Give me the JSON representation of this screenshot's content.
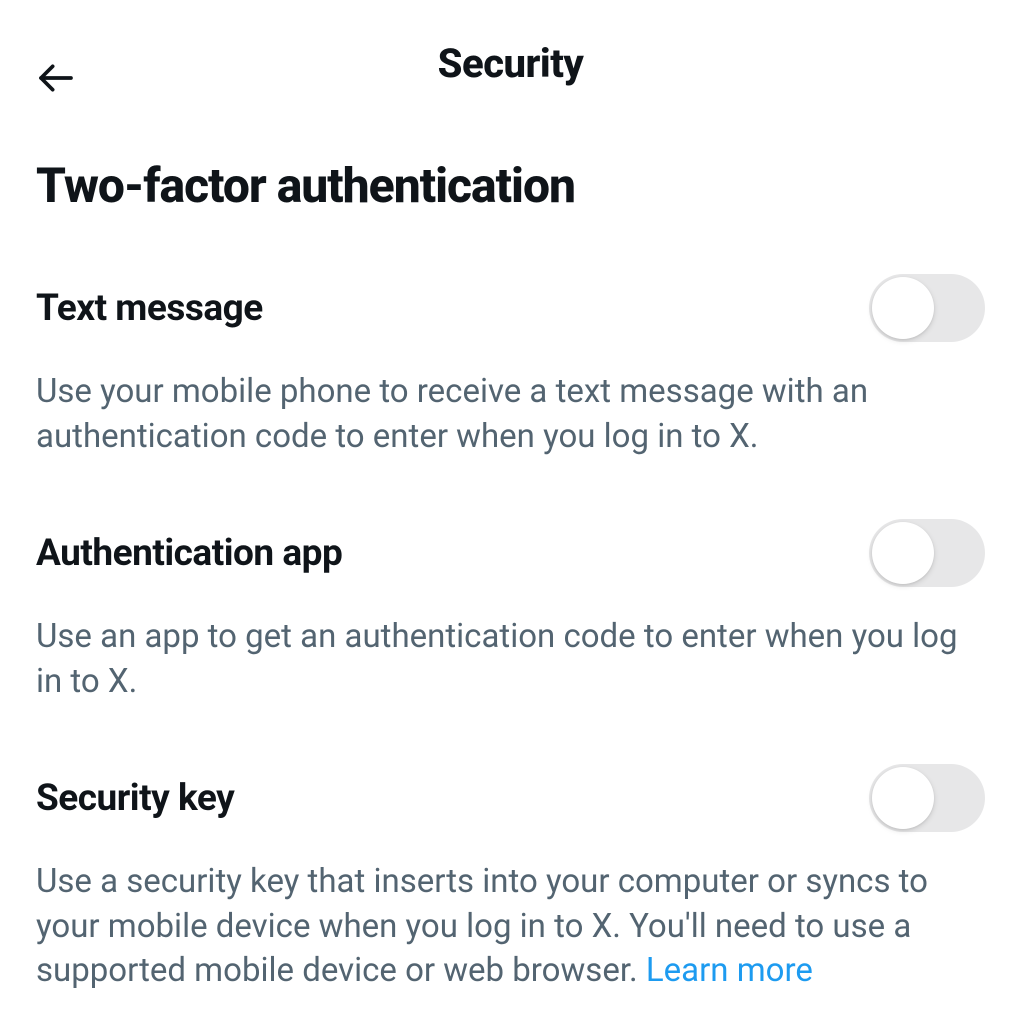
{
  "header": {
    "title": "Security"
  },
  "section": {
    "title": "Two-factor authentication"
  },
  "options": {
    "text_message": {
      "title": "Text message",
      "description": "Use your mobile phone to receive a text message with an authentication code to enter when you log in to X.",
      "enabled": false
    },
    "auth_app": {
      "title": "Authentication app",
      "description": "Use an app to get an authentication code to enter when you log in to X.",
      "enabled": false
    },
    "security_key": {
      "title": "Security key",
      "description": "Use a security key that inserts into your computer or syncs to your mobile device when you log in to X. You'll need to use a supported mobile device or web browser. ",
      "learn_more": "Learn more",
      "enabled": false
    }
  }
}
